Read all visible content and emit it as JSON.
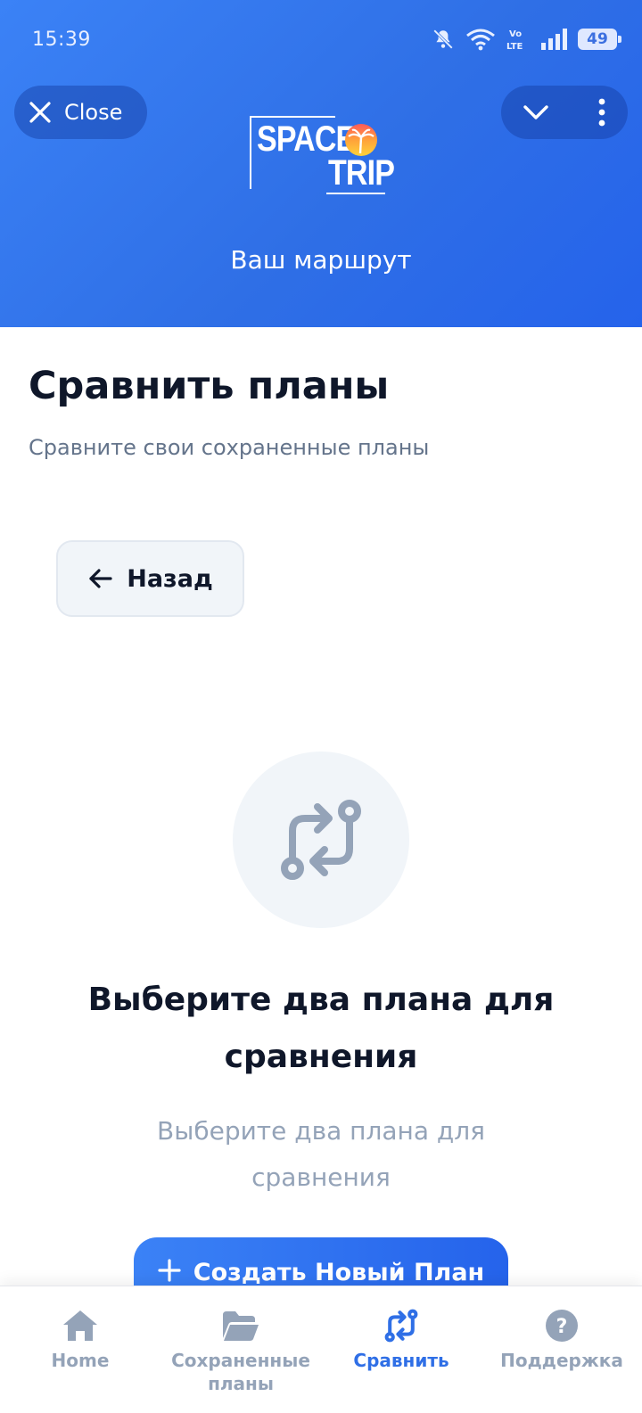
{
  "status_bar": {
    "time": "15:39",
    "battery": "49"
  },
  "header": {
    "close_label": "Close",
    "logo_line1": "SPACE",
    "logo_line2": "TRIP",
    "title": "Ваш маршрут"
  },
  "page": {
    "title": "Сравнить планы",
    "subtitle": "Сравните свои сохраненные планы",
    "back_label": "Назад"
  },
  "empty_state": {
    "title": "Выберите два плана для сравнения",
    "subtitle": "Выберите два плана для сравнения",
    "create_label": "Создать Новый План"
  },
  "nav": {
    "items": [
      {
        "label": "Home",
        "icon": "home-icon"
      },
      {
        "label": "Сохраненные планы",
        "icon": "folder-icon"
      },
      {
        "label": "Сравнить",
        "icon": "compare-icon",
        "active": true
      },
      {
        "label": "Поддержка",
        "icon": "help-icon"
      }
    ]
  },
  "colors": {
    "header_bg": "#2f6fe6",
    "accent": "#2f6fe6",
    "muted": "#94a3b8"
  }
}
